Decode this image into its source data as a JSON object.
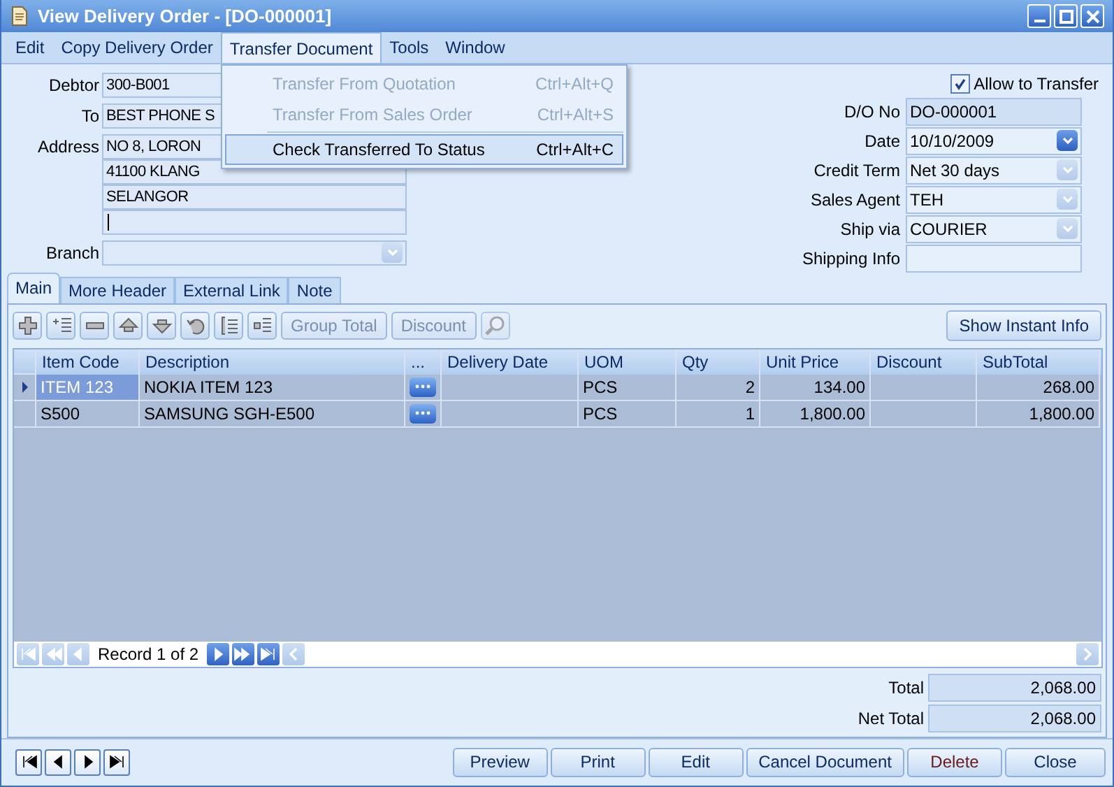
{
  "window": {
    "title": "View Delivery Order - [DO-000001]"
  },
  "menu": [
    {
      "label": "Edit",
      "selected": false
    },
    {
      "label": "Copy Delivery Order",
      "selected": false
    },
    {
      "label": "Transfer Document",
      "selected": true
    },
    {
      "label": "Tools",
      "selected": false
    },
    {
      "label": "Window",
      "selected": false
    }
  ],
  "dropdown": [
    {
      "label": "Transfer From Quotation",
      "shortcut": "Ctrl+Alt+Q",
      "disabled": true,
      "selected": false
    },
    {
      "label": "Transfer From Sales Order",
      "shortcut": "Ctrl+Alt+S",
      "disabled": true,
      "selected": false
    },
    {
      "label": "Check Transferred To Status",
      "shortcut": "Ctrl+Alt+C",
      "disabled": false,
      "selected": true
    }
  ],
  "left_fields": [
    {
      "label": "Debtor",
      "lines": [
        "300-B001"
      ]
    },
    {
      "label": "To",
      "lines": [
        "BEST PHONE S"
      ]
    },
    {
      "label": "Address",
      "lines": [
        "NO 8, LORON",
        "41100 KLANG",
        "SELANGOR"
      ],
      "caret": true
    },
    {
      "label": "Branch",
      "dropdown_enabled": false
    }
  ],
  "allow_transfer": {
    "label": "Allow to Transfer",
    "checked": true
  },
  "right_fields": [
    {
      "label": "D/O No",
      "value": "DO-000001",
      "readonly": true
    },
    {
      "label": "Date",
      "value": "10/10/2009",
      "dropdown_enabled": true
    },
    {
      "label": "Credit Term",
      "value": "Net 30 days",
      "dropdown_enabled": false
    },
    {
      "label": "Sales Agent",
      "value": "TEH",
      "dropdown_enabled": false
    },
    {
      "label": "Ship via",
      "value": "COURIER",
      "dropdown_enabled": false
    },
    {
      "label": "Shipping Info"
    }
  ],
  "tabs": [
    {
      "label": "Main",
      "selected": true
    },
    {
      "label": "More Header",
      "selected": false
    },
    {
      "label": "External Link",
      "selected": false
    },
    {
      "label": "Note",
      "selected": false
    }
  ],
  "toolbar": [
    {
      "kind": "add"
    },
    {
      "kind": "insert"
    },
    {
      "kind": "remove"
    },
    {
      "kind": "up"
    },
    {
      "kind": "down"
    },
    {
      "kind": "undo"
    },
    {
      "kind": "list"
    },
    {
      "kind": "detail"
    },
    {
      "kind": "text",
      "label": "Group Total",
      "disabled": true
    },
    {
      "kind": "text",
      "label": "Discount",
      "disabled": true
    },
    {
      "kind": "search",
      "disabled": true
    }
  ],
  "instant_info_button": "Show Instant Info",
  "table": {
    "columns": [
      "Item Code",
      "Description",
      "...",
      "Delivery Date",
      "UOM",
      "Qty",
      "Unit Price",
      "Discount",
      "SubTotal"
    ],
    "rows": [
      {
        "selected": true,
        "cells": [
          "ITEM 123",
          "NOKIA ITEM 123",
          "",
          "",
          "PCS",
          "2",
          "134.00",
          "",
          "268.00"
        ]
      },
      {
        "selected": false,
        "cells": [
          "S500",
          "SAMSUNG SGH-E500",
          "",
          "",
          "PCS",
          "1",
          "1,800.00",
          "",
          "1,800.00"
        ]
      }
    ]
  },
  "grid_nav": {
    "record": "Record 1 of 2",
    "buttons": [
      {
        "kind": "first",
        "disabled": true
      },
      {
        "kind": "prev-page",
        "disabled": true
      },
      {
        "kind": "prev",
        "disabled": true
      },
      {
        "kind": "next",
        "disabled": false
      },
      {
        "kind": "next-page",
        "disabled": false
      },
      {
        "kind": "last",
        "disabled": false
      }
    ]
  },
  "totals": [
    {
      "label": "Total",
      "value": "2,068.00"
    },
    {
      "label": "Net Total",
      "value": "2,068.00"
    }
  ],
  "record_nav": [
    {
      "kind": "first"
    },
    {
      "kind": "prev"
    },
    {
      "kind": "next"
    },
    {
      "kind": "last"
    }
  ],
  "buttons": [
    {
      "label": "Preview",
      "kind": "normal"
    },
    {
      "label": "Print",
      "kind": "normal"
    },
    {
      "label": "Edit",
      "kind": "normal"
    },
    {
      "label": "Cancel Document",
      "kind": "normal"
    },
    {
      "label": "Delete",
      "kind": "danger"
    },
    {
      "label": "Close",
      "kind": "normal"
    }
  ]
}
